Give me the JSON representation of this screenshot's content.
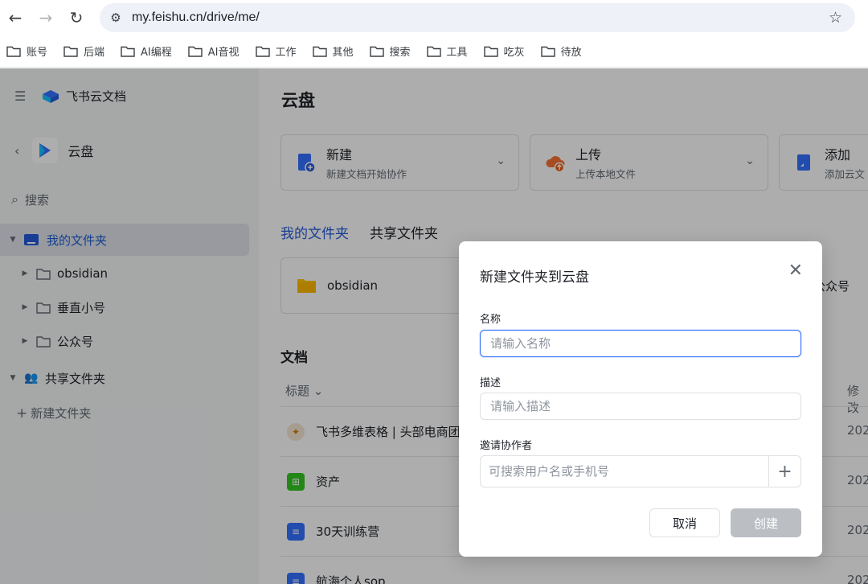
{
  "browser": {
    "url": "my.feishu.cn/drive/me/",
    "bookmarks": [
      "账号",
      "后端",
      "AI编程",
      "AI音视",
      "工作",
      "其他",
      "搜索",
      "工具",
      "吃灰",
      "待放"
    ]
  },
  "sidebar": {
    "app_name": "飞书云文档",
    "drive_label": "云盘",
    "search_placeholder": "搜索",
    "my_folder": "我的文件夹",
    "children": [
      "obsidian",
      "垂直小号",
      "公众号"
    ],
    "shared_folder": "共享文件夹",
    "new_folder": "新建文件夹"
  },
  "main": {
    "title": "云盘",
    "actions": [
      {
        "title": "新建",
        "desc": "新建文档开始协作"
      },
      {
        "title": "上传",
        "desc": "上传本地文件"
      },
      {
        "title": "添加",
        "desc": "添加云文"
      }
    ],
    "tabs": [
      "我的文件夹",
      "共享文件夹"
    ],
    "folder_cards": [
      "obsidian",
      "公众号"
    ],
    "docs_title": "文档",
    "col_title": "标题",
    "col_modified": "修改",
    "docs": [
      {
        "name": "飞书多维表格 | 头部电商团",
        "date": "202"
      },
      {
        "name": "资产",
        "date": "202"
      },
      {
        "name": "30天训练营",
        "date": "202"
      },
      {
        "name": "航海个人sop",
        "date": "202"
      }
    ]
  },
  "modal": {
    "title": "新建文件夹到云盘",
    "name_label": "名称",
    "name_placeholder": "请输入名称",
    "desc_label": "描述",
    "desc_placeholder": "请输入描述",
    "invite_label": "邀请协作者",
    "invite_placeholder": "可搜索用户名或手机号",
    "cancel": "取消",
    "create": "创建"
  },
  "colors": {
    "accent": "#245bdb",
    "disabled_button": "#bbbfc4"
  }
}
